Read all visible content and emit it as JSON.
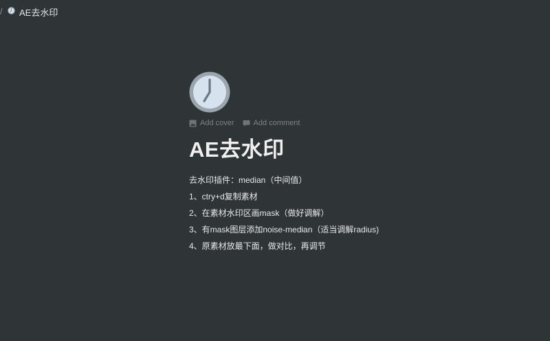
{
  "breadcrumb": {
    "separator": "/",
    "icon": "clock-icon",
    "title": "AE去水印"
  },
  "page": {
    "icon": "clock-icon",
    "controls": {
      "add_cover": "Add cover",
      "add_comment": "Add comment"
    },
    "title": "AE去水印",
    "lines": [
      "去水印插件：median（中间值）",
      "1、ctry+d复制素材",
      "2、在素材水印区画mask（做好调解）",
      "3、有mask图层添加noise-median（适当调解radius)",
      "4、原素材放最下面，做对比，再调节"
    ]
  },
  "colors": {
    "background": "#2f3437",
    "clock_face": "#d6e3ef",
    "clock_rim": "#9aa5ad",
    "clock_hands": "#6d7780"
  }
}
